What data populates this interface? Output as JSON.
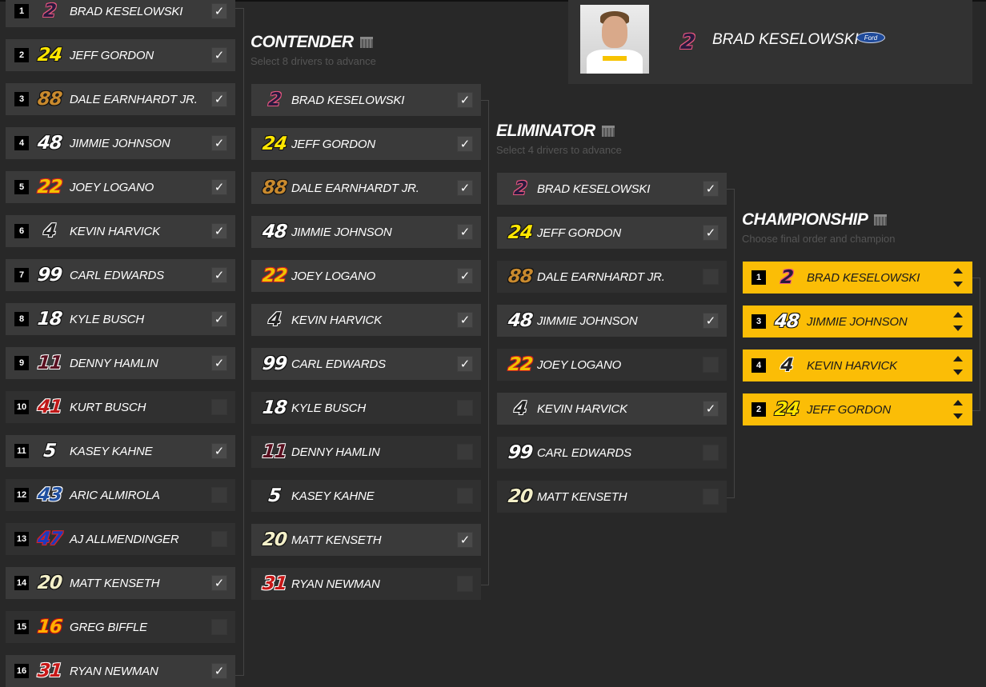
{
  "colors": {
    "bg": "#282828",
    "gold": "#fbbd06",
    "check": "#ffffff"
  },
  "hero": {
    "number": "2",
    "name": "BRAD KESELOWSKI",
    "manufacturer": "Ford",
    "number_color": "#2a1a3e",
    "number_outline": "#e8577f"
  },
  "round1": {
    "drivers": [
      {
        "seed": "1",
        "number": "2",
        "name": "BRAD KESELOWSKI",
        "checked": true,
        "color": "#2a1a3e",
        "outline": "#e8577f"
      },
      {
        "seed": "2",
        "number": "24",
        "name": "JEFF GORDON",
        "checked": true,
        "color": "#ffe600",
        "outline": "#111"
      },
      {
        "seed": "3",
        "number": "88",
        "name": "DALE EARNHARDT JR.",
        "checked": true,
        "color": "#c98a2e",
        "outline": "#111"
      },
      {
        "seed": "4",
        "number": "48",
        "name": "JIMMIE JOHNSON",
        "checked": true,
        "color": "#ffffff",
        "outline": "#111"
      },
      {
        "seed": "5",
        "number": "22",
        "name": "JOEY LOGANO",
        "checked": true,
        "color": "#f2c200",
        "outline": "#d02020"
      },
      {
        "seed": "6",
        "number": "4",
        "name": "KEVIN HARVICK",
        "checked": true,
        "color": "#222222",
        "outline": "#ffffff"
      },
      {
        "seed": "7",
        "number": "99",
        "name": "CARL EDWARDS",
        "checked": true,
        "color": "#ffffff",
        "outline": "#111"
      },
      {
        "seed": "8",
        "number": "18",
        "name": "KYLE BUSCH",
        "checked": true,
        "color": "#ffffff",
        "outline": "#111"
      },
      {
        "seed": "9",
        "number": "11",
        "name": "DENNY HAMLIN",
        "checked": true,
        "color": "#5a1020",
        "outline": "#ffffff"
      },
      {
        "seed": "10",
        "number": "41",
        "name": "KURT BUSCH",
        "checked": false,
        "color": "#c01818",
        "outline": "#ffffff"
      },
      {
        "seed": "11",
        "number": "5",
        "name": "KASEY KAHNE",
        "checked": true,
        "color": "#ffffff",
        "outline": "#111"
      },
      {
        "seed": "12",
        "number": "43",
        "name": "ARIC ALMIROLA",
        "checked": false,
        "color": "#1f4fa0",
        "outline": "#ffffff"
      },
      {
        "seed": "13",
        "number": "47",
        "name": "AJ ALLMENDINGER",
        "checked": false,
        "color": "#1d3bbd",
        "outline": "#e02020"
      },
      {
        "seed": "14",
        "number": "20",
        "name": "MATT KENSETH",
        "checked": true,
        "color": "#f3efc8",
        "outline": "#111"
      },
      {
        "seed": "15",
        "number": "16",
        "name": "GREG BIFFLE",
        "checked": false,
        "color": "#ffb000",
        "outline": "#c01010"
      },
      {
        "seed": "16",
        "number": "31",
        "name": "RYAN NEWMAN",
        "checked": true,
        "color": "#c81818",
        "outline": "#ffffff"
      }
    ]
  },
  "contender": {
    "title": "CONTENDER",
    "subtitle": "Select 8 drivers to advance",
    "drivers": [
      {
        "number": "2",
        "name": "BRAD KESELOWSKI",
        "checked": true,
        "color": "#2a1a3e",
        "outline": "#e8577f"
      },
      {
        "number": "24",
        "name": "JEFF GORDON",
        "checked": true,
        "color": "#ffe600",
        "outline": "#111"
      },
      {
        "number": "88",
        "name": "DALE EARNHARDT JR.",
        "checked": true,
        "color": "#c98a2e",
        "outline": "#111"
      },
      {
        "number": "48",
        "name": "JIMMIE JOHNSON",
        "checked": true,
        "color": "#ffffff",
        "outline": "#111"
      },
      {
        "number": "22",
        "name": "JOEY LOGANO",
        "checked": true,
        "color": "#f2c200",
        "outline": "#d02020"
      },
      {
        "number": "4",
        "name": "KEVIN HARVICK",
        "checked": true,
        "color": "#222222",
        "outline": "#ffffff"
      },
      {
        "number": "99",
        "name": "CARL EDWARDS",
        "checked": true,
        "color": "#ffffff",
        "outline": "#111"
      },
      {
        "number": "18",
        "name": "KYLE BUSCH",
        "checked": false,
        "color": "#ffffff",
        "outline": "#111"
      },
      {
        "number": "11",
        "name": "DENNY HAMLIN",
        "checked": false,
        "color": "#5a1020",
        "outline": "#ffffff"
      },
      {
        "number": "5",
        "name": "KASEY KAHNE",
        "checked": false,
        "color": "#ffffff",
        "outline": "#111"
      },
      {
        "number": "20",
        "name": "MATT KENSETH",
        "checked": true,
        "color": "#f3efc8",
        "outline": "#111"
      },
      {
        "number": "31",
        "name": "RYAN NEWMAN",
        "checked": false,
        "color": "#c81818",
        "outline": "#ffffff"
      }
    ]
  },
  "eliminator": {
    "title": "ELIMINATOR",
    "subtitle": "Select 4 drivers to advance",
    "drivers": [
      {
        "number": "2",
        "name": "BRAD KESELOWSKI",
        "checked": true,
        "color": "#2a1a3e",
        "outline": "#e8577f"
      },
      {
        "number": "24",
        "name": "JEFF GORDON",
        "checked": true,
        "color": "#ffe600",
        "outline": "#111"
      },
      {
        "number": "88",
        "name": "DALE EARNHARDT JR.",
        "checked": false,
        "color": "#c98a2e",
        "outline": "#111"
      },
      {
        "number": "48",
        "name": "JIMMIE JOHNSON",
        "checked": true,
        "color": "#ffffff",
        "outline": "#111"
      },
      {
        "number": "22",
        "name": "JOEY LOGANO",
        "checked": false,
        "color": "#f2c200",
        "outline": "#d02020"
      },
      {
        "number": "4",
        "name": "KEVIN HARVICK",
        "checked": true,
        "color": "#222222",
        "outline": "#ffffff"
      },
      {
        "number": "99",
        "name": "CARL EDWARDS",
        "checked": false,
        "color": "#ffffff",
        "outline": "#111"
      },
      {
        "number": "20",
        "name": "MATT KENSETH",
        "checked": false,
        "color": "#f3efc8",
        "outline": "#111"
      }
    ]
  },
  "championship": {
    "title": "CHAMPIONSHIP",
    "subtitle": "Choose final order and champion",
    "drivers": [
      {
        "seed": "1",
        "number": "2",
        "name": "BRAD KESELOWSKI",
        "color": "#2a1a3e",
        "outline": "#e8577f"
      },
      {
        "seed": "3",
        "number": "48",
        "name": "JIMMIE JOHNSON",
        "color": "#ffffff",
        "outline": "#111"
      },
      {
        "seed": "4",
        "number": "4",
        "name": "KEVIN HARVICK",
        "color": "#222222",
        "outline": "#ffffff"
      },
      {
        "seed": "2",
        "number": "24",
        "name": "JEFF GORDON",
        "color": "#ffe600",
        "outline": "#111"
      }
    ]
  }
}
